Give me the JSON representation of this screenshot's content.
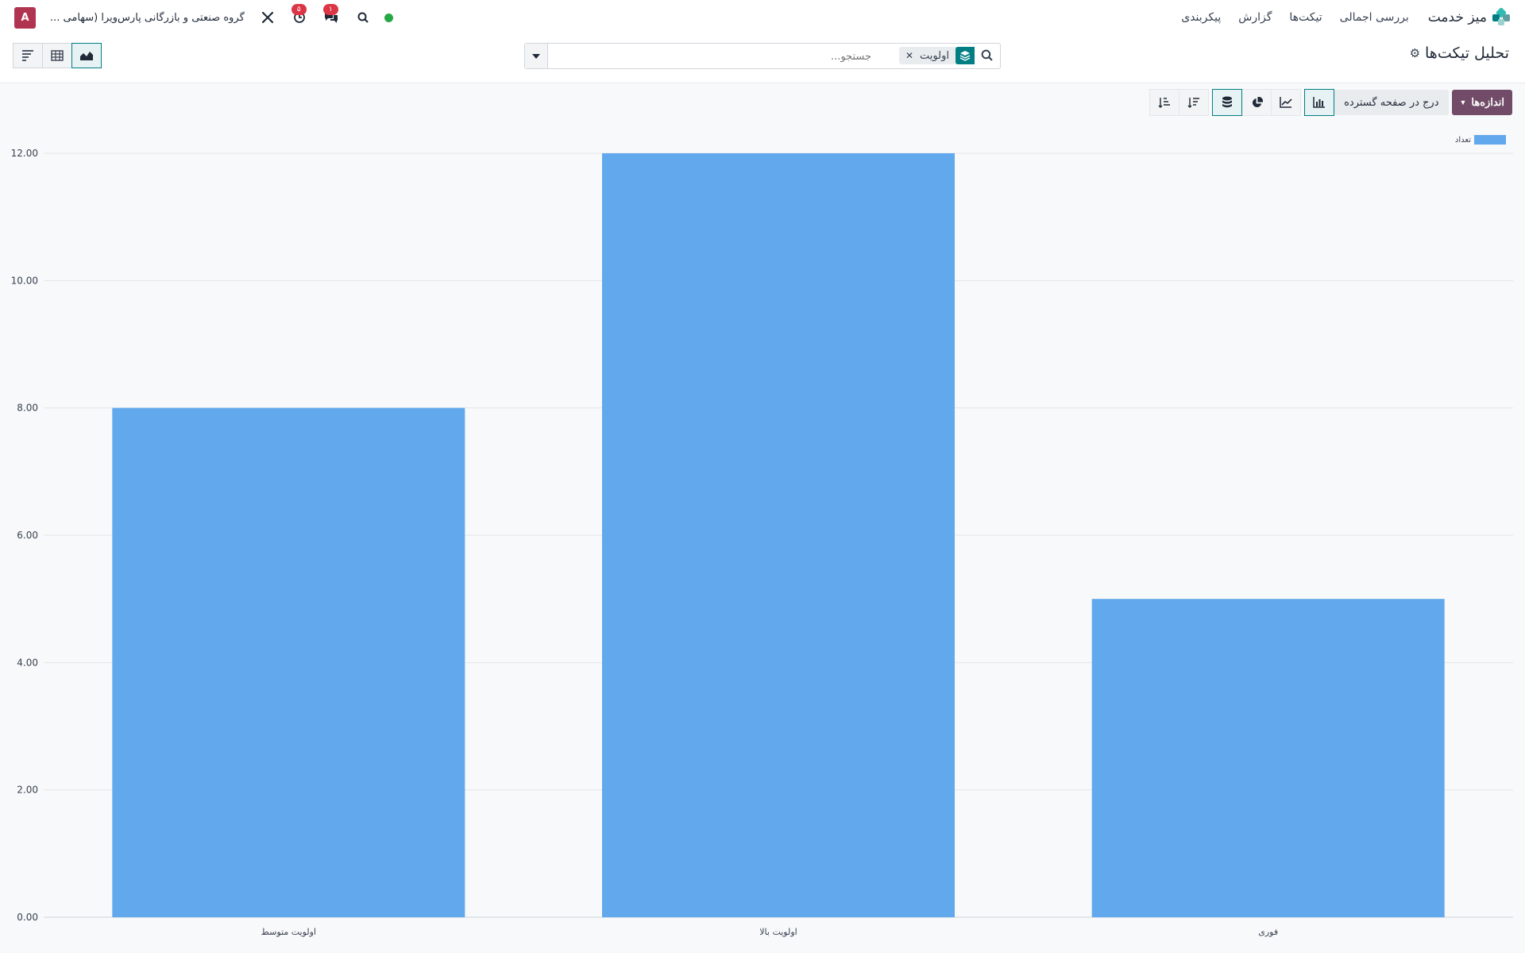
{
  "navbar": {
    "app_name": "میز خدمت",
    "menu": [
      "بررسی اجمالی",
      "تیکت‌ها",
      "گزارش",
      "پیکربندی"
    ],
    "company": "گروه صنعتی و بازرگانی پارس‌ویرا (سهامی ...",
    "activity_badge": "۵",
    "messages_badge": "۱",
    "avatar_letter": "A",
    "colors": {
      "primary": "#714b67",
      "teal": "#017e84",
      "badge": "#dc3545",
      "online": "#28a745"
    }
  },
  "control": {
    "title": "تحلیل تیکت‌ها",
    "search": {
      "placeholder": "جستجو...",
      "facet": "اولویت"
    }
  },
  "toolbar": {
    "measures": "اندازه‌ها",
    "insert_spreadsheet": "درج در صفحه گسترده"
  },
  "chart_data": {
    "type": "bar",
    "categories": [
      "اولویت متوسط",
      "اولویت بالا",
      "فوری"
    ],
    "series": [
      {
        "name": "تعداد",
        "values": [
          8,
          12,
          5
        ],
        "color": "#62a8ec"
      }
    ],
    "ylim": [
      0,
      12
    ],
    "yticks": [
      "0.00",
      "2.00",
      "4.00",
      "6.00",
      "8.00",
      "10.00",
      "12.00"
    ],
    "grid": true,
    "legend": "top-right"
  }
}
